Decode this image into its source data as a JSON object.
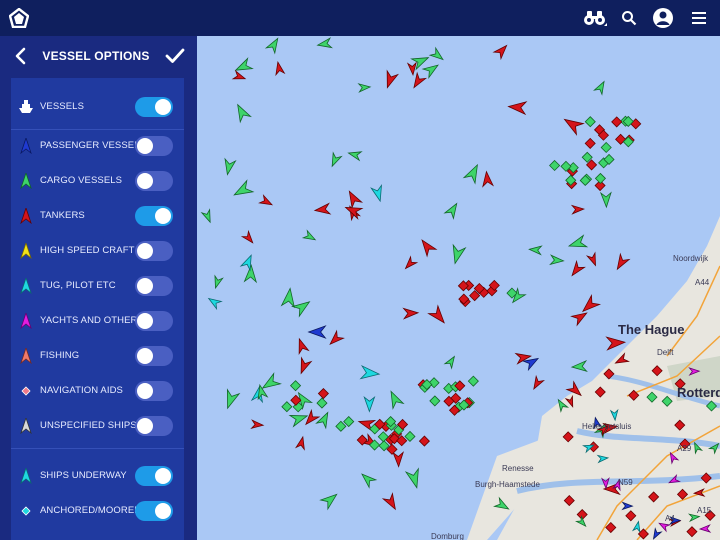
{
  "header": {
    "icons": [
      "home-logo-icon",
      "binoculars-icon",
      "search-icon",
      "user-icon",
      "menu-icon"
    ]
  },
  "panel": {
    "title": "VESSEL OPTIONS",
    "items": [
      {
        "label": "VESSELS",
        "icon": "ship-icon",
        "color": "#ffffff",
        "on": true
      },
      {
        "label": "PASSENGER VESSELS",
        "icon": "arrow-icon",
        "color": "#1f3ad0",
        "on": false
      },
      {
        "label": "CARGO VESSELS",
        "icon": "arrow-icon",
        "color": "#3ed46a",
        "on": false
      },
      {
        "label": "TANKERS",
        "icon": "arrow-icon",
        "color": "#d4141a",
        "on": true
      },
      {
        "label": "HIGH SPEED CRAFT",
        "icon": "arrow-icon",
        "color": "#f2e21a",
        "on": false
      },
      {
        "label": "TUG, PILOT ETC",
        "icon": "arrow-icon",
        "color": "#1ed8e0",
        "on": false
      },
      {
        "label": "YACHTS AND OTHERS",
        "icon": "arrow-icon",
        "color": "#e21ee0",
        "on": false
      },
      {
        "label": "FISHING",
        "icon": "arrow-icon",
        "color": "#f07a6a",
        "on": false
      },
      {
        "label": "NAVIGATION AIDS",
        "icon": "diamond-icon",
        "color": "#f07a8a",
        "on": false
      },
      {
        "label": "UNSPECIFIED SHIPS",
        "icon": "arrow-icon",
        "color": "#cccccc",
        "on": false
      },
      {
        "label": "SHIPS UNDERWAY",
        "icon": "arrow-icon",
        "color": "#1ed8e0",
        "on": true
      },
      {
        "label": "ANCHORED/MOORED",
        "icon": "diamond-icon",
        "color": "#1ed8e0",
        "on": true
      }
    ]
  },
  "map": {
    "places": [
      "Noordwijk",
      "The Hague",
      "Delft",
      "Rotterdam",
      "Hellevoetsluis",
      "Renesse",
      "Burgh-Haamstede",
      "Domburg",
      "A44",
      "A4",
      "A29",
      "N59",
      "A15"
    ],
    "colors": {
      "sea": "#aac8f5",
      "land": "#e8e6df",
      "tanker": "#d4141a",
      "cargo": "#3ed46a",
      "passenger": "#1f3ad0",
      "tug": "#1ed8e0",
      "yacht": "#e21ee0"
    }
  }
}
